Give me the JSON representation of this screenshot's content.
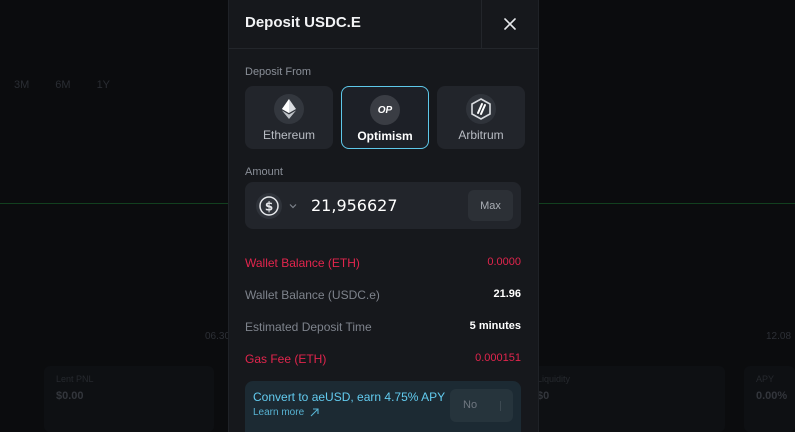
{
  "background": {
    "tabs": [
      "3M",
      "6M",
      "1Y"
    ],
    "left_label": "06.30",
    "right_label": "12.08",
    "cards": [
      {
        "label": "Lent PNL",
        "value": "$0.00"
      },
      {
        "label": "Liquidity",
        "value": "$0"
      },
      {
        "label": "APY",
        "value": "0.00%"
      }
    ]
  },
  "modal": {
    "title": "Deposit USDC.E",
    "deposit_from_label": "Deposit From",
    "chains": [
      {
        "name": "Ethereum",
        "icon": "ethereum-icon",
        "selected": false
      },
      {
        "name": "Optimism",
        "icon": "optimism-icon",
        "badge": "OP",
        "selected": true
      },
      {
        "name": "Arbitrum",
        "icon": "arbitrum-icon",
        "selected": false
      }
    ],
    "amount_label": "Amount",
    "amount_value": "21,956627",
    "max_label": "Max",
    "rows": [
      {
        "label": "Wallet Balance (ETH)",
        "value": "0.0000",
        "warn": true
      },
      {
        "label": "Wallet Balance (USDC.e)",
        "value": "21.96",
        "warn": false
      },
      {
        "label": "Estimated Deposit Time",
        "value": "5 minutes",
        "warn": false
      },
      {
        "label": "Gas Fee (ETH)",
        "value": "0.000151",
        "warn": true
      }
    ],
    "convert": {
      "title": "Convert to aeUSD, earn 4.75% APY",
      "learn_more": "Learn more",
      "toggle_label": "No"
    }
  },
  "colors": {
    "accent": "#5ec8ea",
    "warning": "#e2254d",
    "modal_bg": "#16181c",
    "card_bg": "#22252b"
  }
}
